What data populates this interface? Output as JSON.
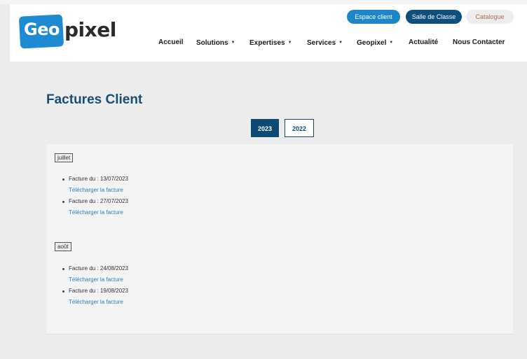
{
  "header": {
    "logo": {
      "part1": "Geo",
      "part2": "pixel"
    },
    "top_buttons": [
      "Espace client",
      "Salle de Classe",
      "Catalogue"
    ],
    "nav": [
      {
        "label": "Accueil",
        "dropdown": false
      },
      {
        "label": "Solutions",
        "dropdown": true
      },
      {
        "label": "Expertises",
        "dropdown": true
      },
      {
        "label": "Services",
        "dropdown": true
      },
      {
        "label": "Geopixel",
        "dropdown": true
      },
      {
        "label": "Actualité",
        "dropdown": false
      },
      {
        "label": "Nous Contacter",
        "dropdown": false
      }
    ],
    "caret": "▼"
  },
  "page": {
    "title": "Factures Client",
    "years": {
      "active": "2023",
      "other": "2022"
    },
    "months": [
      {
        "label": "juillet",
        "invoices": [
          {
            "text": "Facture du : 13/07/2023",
            "link": "Télécharger la facture"
          },
          {
            "text": "Facture du : 27/07/2023",
            "link": "Télécharger la facture"
          }
        ]
      },
      {
        "label": "août",
        "invoices": [
          {
            "text": "Facture du : 24/08/2023",
            "link": "Télécharger la facture"
          },
          {
            "text": "Facture du : 19/08/2023",
            "link": "Télécharger la facture"
          }
        ]
      }
    ]
  },
  "colors": {
    "brand_blue": "#1d86c9",
    "dark_blue": "#0d4a73",
    "title_blue": "#154f78",
    "link_blue": "#2b7bc4",
    "catalogue_text": "#b06a52"
  }
}
